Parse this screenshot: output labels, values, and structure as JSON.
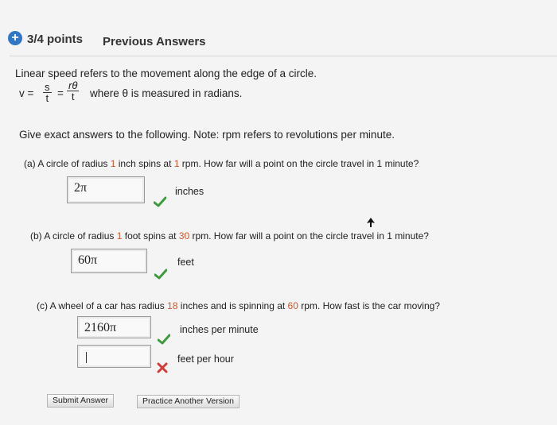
{
  "header": {
    "score": "3/4 points",
    "previous_answers": "Previous Answers"
  },
  "intro": {
    "line1": "Linear speed refers to the movement along the edge of a circle.",
    "v_eq": "v =",
    "s_num": "s",
    "t_den": "t",
    "eq2": "=",
    "rtheta_num": "rθ",
    "t_den2": "t",
    "where_text": "where θ is measured in radians."
  },
  "instructions": "Give exact answers to the following. Note: rpm refers to revolutions per minute.",
  "part_a": {
    "prefix": "(a) A circle of radius ",
    "radius": "1",
    "mid1": " inch spins at ",
    "rpm": "1",
    "suffix": " rpm. How far will a point on the circle travel in 1 minute?",
    "answer": "2π",
    "unit": "inches",
    "status": "correct"
  },
  "part_b": {
    "prefix": "(b) A circle of radius ",
    "radius": "1",
    "mid1": " foot spins at ",
    "rpm": "30",
    "suffix": " rpm. How far will a point on the circle travel in 1 minute?",
    "answer": "60π",
    "unit": "feet",
    "status": "correct"
  },
  "part_c": {
    "prefix": "(c) A wheel of a car has radius ",
    "radius": "18",
    "mid1": " inches and is spinning at ",
    "rpm": "60",
    "suffix": " rpm. How fast is the car moving?",
    "answer1": "2160π",
    "unit1": "inches per minute",
    "status1": "correct",
    "answer2": "",
    "unit2": "feet per hour",
    "status2": "incorrect"
  },
  "buttons": {
    "submit": "Submit Answer",
    "practice": "Practice Another Version"
  },
  "colors": {
    "highlight": "#d6542a",
    "correct": "#3f9a3f",
    "incorrect": "#d33a3a",
    "plus_badge": "#2f76c6"
  }
}
